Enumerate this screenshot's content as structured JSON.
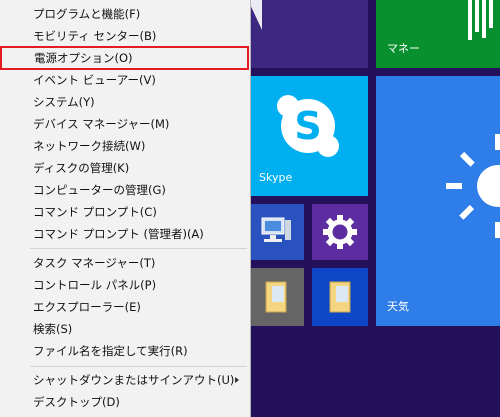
{
  "context_menu": {
    "items": [
      {
        "label": "プログラムと機能(F)"
      },
      {
        "label": "モビリティ センター(B)"
      },
      {
        "label": "電源オプション(O)"
      },
      {
        "label": "イベント ビューアー(V)"
      },
      {
        "label": "システム(Y)"
      },
      {
        "label": "デバイス マネージャー(M)"
      },
      {
        "label": "ネットワーク接続(W)"
      },
      {
        "label": "ディスクの管理(K)"
      },
      {
        "label": "コンピューターの管理(G)"
      },
      {
        "label": "コマンド プロンプト(C)"
      },
      {
        "label": "コマンド プロンプト (管理者)(A)"
      },
      {
        "label": "タスク マネージャー(T)"
      },
      {
        "label": "コントロール パネル(P)"
      },
      {
        "label": "エクスプローラー(E)"
      },
      {
        "label": "検索(S)"
      },
      {
        "label": "ファイル名を指定して実行(R)"
      },
      {
        "label": "シャットダウンまたはサインアウト(U)"
      },
      {
        "label": "デスクトップ(D)"
      }
    ],
    "highlight_color": "#e51c23"
  },
  "tiles": {
    "money": {
      "label": "マネー",
      "color": "#07902d"
    },
    "skype": {
      "label": "Skype",
      "color": "#00aff0"
    },
    "weather": {
      "label": "天気",
      "color": "#2f7de8"
    }
  }
}
